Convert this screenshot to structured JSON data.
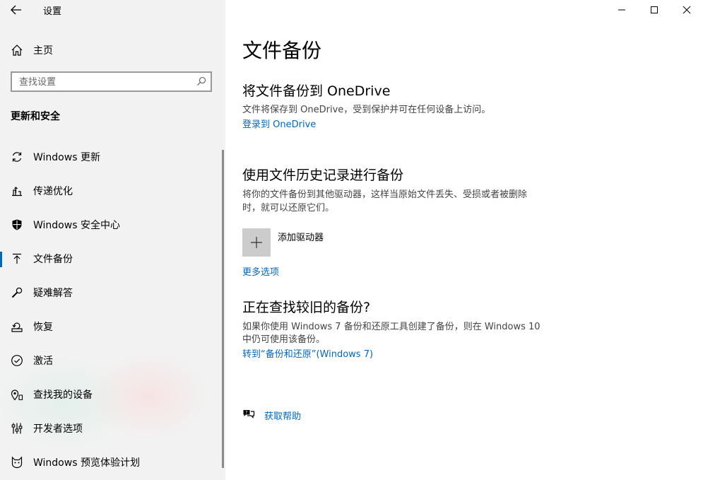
{
  "app": {
    "title": "设置"
  },
  "sidebar": {
    "home_label": "主页",
    "search_placeholder": "查找设置",
    "section_title": "更新和安全",
    "items": [
      {
        "label": "Windows 更新",
        "icon": "refresh-icon",
        "active": false
      },
      {
        "label": "传递优化",
        "icon": "delivery-optimization-icon",
        "active": false
      },
      {
        "label": "Windows 安全中心",
        "icon": "shield-icon",
        "active": false
      },
      {
        "label": "文件备份",
        "icon": "backup-arrow-icon",
        "active": true
      },
      {
        "label": "疑难解答",
        "icon": "wrench-icon",
        "active": false
      },
      {
        "label": "恢复",
        "icon": "recovery-icon",
        "active": false
      },
      {
        "label": "激活",
        "icon": "checkmark-circle-icon",
        "active": false
      },
      {
        "label": "查找我的设备",
        "icon": "find-device-icon",
        "active": false
      },
      {
        "label": "开发者选项",
        "icon": "developer-icon",
        "active": false
      },
      {
        "label": "Windows 预览体验计划",
        "icon": "insider-cat-icon",
        "active": false
      }
    ]
  },
  "main": {
    "page_title": "文件备份",
    "onedrive": {
      "heading": "将文件备份到 OneDrive",
      "description": "文件将保存到 OneDrive，受到保护并可在任何设备上访问。",
      "link": "登录到 OneDrive"
    },
    "file_history": {
      "heading": "使用文件历史记录进行备份",
      "description_line1": "将你的文件备份到其他驱动器，这样当原始文件丢失、受损或者被删除",
      "description_line2": "时，就可以还原它们。",
      "add_drive_label": "添加驱动器",
      "more_options_link": "更多选项"
    },
    "older_backup": {
      "heading": "正在查找较旧的备份?",
      "description_line1": "如果你使用 Windows 7 备份和还原工具创建了备份，则在 Windows 10",
      "description_line2": "中仍可使用该备份。",
      "link": "转到“备份和还原”(Windows 7)"
    },
    "help_label": "获取帮助"
  },
  "colors": {
    "accent": "#0067c0",
    "sidebar_bg": "#f2f2f2"
  }
}
